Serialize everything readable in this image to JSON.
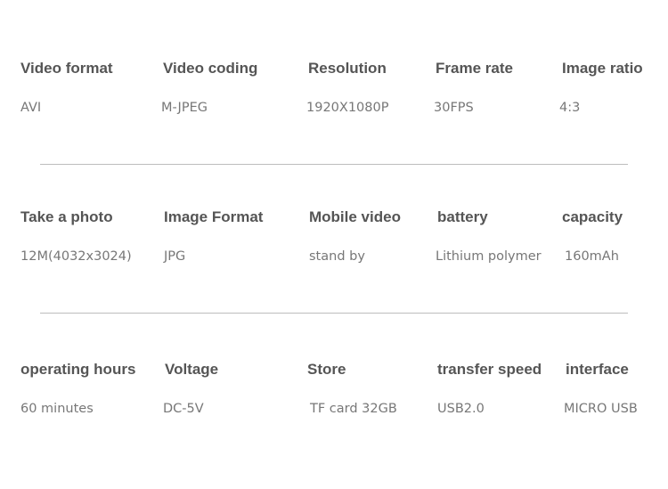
{
  "rows": [
    {
      "labels": [
        "Video format",
        "Video coding",
        "Resolution",
        "Frame rate",
        "Image ratio"
      ],
      "values": [
        "AVI",
        "M-JPEG",
        "1920X1080P",
        "30FPS",
        "4:3"
      ]
    },
    {
      "labels": [
        "Take a photo",
        "Image Format",
        "Mobile video",
        "battery",
        "capacity"
      ],
      "values": [
        "12M(4032x3024)",
        "JPG",
        "stand by",
        "Lithium polymer",
        "160mAh"
      ]
    },
    {
      "labels": [
        "operating hours",
        "Voltage",
        "Store",
        "transfer speed",
        "interface"
      ],
      "values": [
        "60 minutes",
        "DC-5V",
        "TF card 32GB",
        "USB2.0",
        "MICRO USB"
      ]
    }
  ],
  "colors": {
    "label": "#555555",
    "value": "#777777",
    "divider": "#bdbdbd"
  }
}
